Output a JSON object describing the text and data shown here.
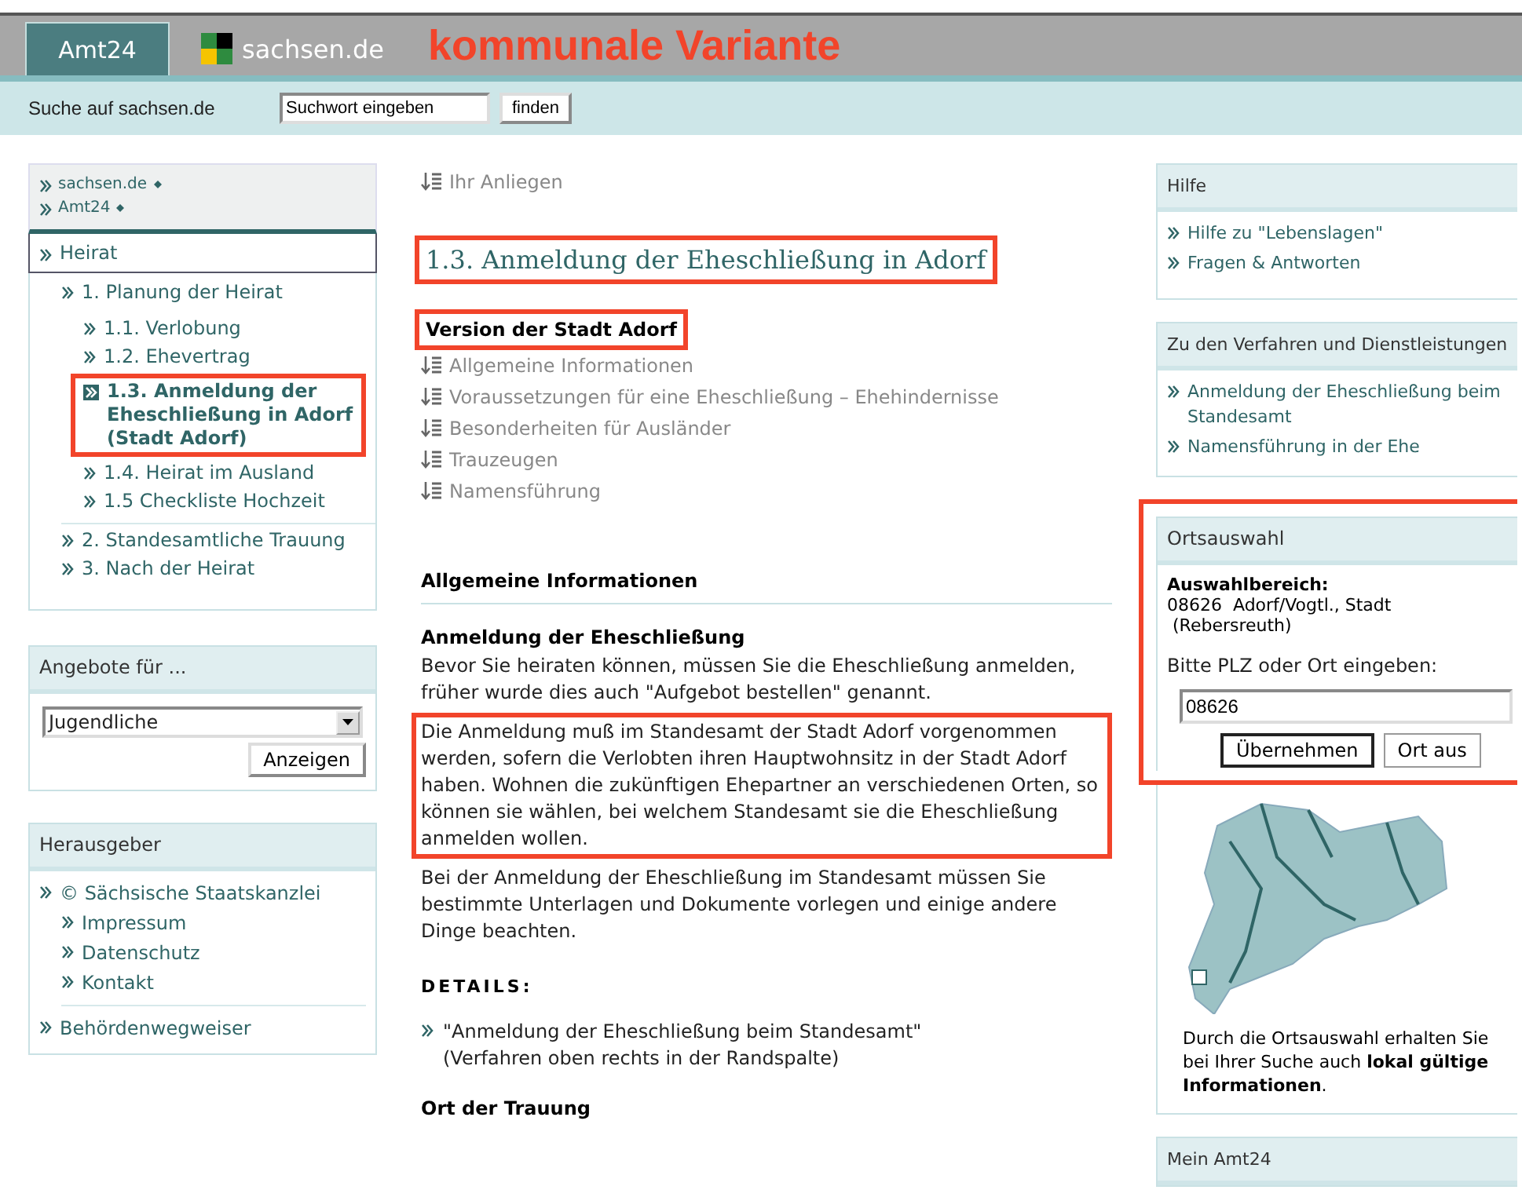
{
  "header": {
    "tab": {
      "label": "Amt24",
      "selected": true
    },
    "logo_text": "sachsen.de",
    "annotation": "kommunale Variante"
  },
  "search": {
    "label": "Suche auf sachsen.de",
    "value": "Suchwort eingeben",
    "button": "finden"
  },
  "breadcrumbs": [
    "sachsen.de",
    "Amt24"
  ],
  "nav": {
    "label": "Heirat",
    "children": [
      {
        "label": "1. Planung der Heirat",
        "selected": false,
        "highlighted": false,
        "children": [
          {
            "label": "1.1. Verlobung",
            "selected": false,
            "highlighted": false
          },
          {
            "label": "1.2. Ehevertrag",
            "selected": false,
            "highlighted": false
          },
          {
            "label": "1.3. Anmeldung der Eheschließung in Adorf (Stadt Adorf)",
            "selected": true,
            "highlighted": true
          },
          {
            "label": "1.4. Heirat im Ausland",
            "selected": false,
            "highlighted": false
          },
          {
            "label": "1.5 Checkliste Hochzeit",
            "selected": false,
            "highlighted": false
          }
        ]
      },
      {
        "label": "2. Standesamtliche Trauung",
        "selected": false,
        "highlighted": false
      },
      {
        "label": "3. Nach der Heirat",
        "selected": false,
        "highlighted": false
      }
    ]
  },
  "offers": {
    "title": "Angebote für ...",
    "select": "Jugendliche",
    "button": "Anzeigen"
  },
  "publisher": {
    "title": "Herausgeber",
    "items": [
      {
        "label": "© Sächsische Staatskanzlei",
        "children": [
          {
            "label": "Impressum"
          },
          {
            "label": "Datenschutz"
          },
          {
            "label": "Kontakt"
          }
        ]
      },
      {
        "label": "Behördenwegweiser"
      }
    ]
  },
  "main": {
    "top_link": "Ihr Anliegen",
    "title": {
      "text": "1.3. Anmeldung der Eheschließung in Adorf",
      "highlighted": true
    },
    "version": {
      "text": "Version der Stadt Adorf",
      "highlighted": true
    },
    "toc": [
      "Allgemeine Informationen",
      "Voraussetzungen für eine Eheschließung – Ehehindernisse",
      "Besonderheiten für Ausländer",
      "Trauzeugen",
      "Namensführung"
    ],
    "section": "Allgemeine Informationen",
    "subsection": "Anmeldung der Eheschließung",
    "paragraphs": [
      {
        "text": "Bevor Sie heiraten können, müssen Sie die Eheschließung anmelden, früher wurde dies auch \"Aufgebot bestellen\" genannt.",
        "highlighted": false
      },
      {
        "text": "Die Anmeldung muß im Standesamt der Stadt Adorf vorgenommen werden, sofern die Verlobten ihren Hauptwohnsitz in der Stadt Adorf haben. Wohnen die zukünftigen Ehepartner an verschiedenen Orten, so können sie wählen, bei welchem Standesamt sie die Eheschließung anmelden wollen.",
        "highlighted": true
      },
      {
        "text": "Bei der Anmeldung der Eheschließung im Standesamt müssen Sie bestimmte Unterlagen und Dokumente vorlegen und einige andere Dinge beachten.",
        "highlighted": false
      }
    ],
    "details_label": "DETAILS:",
    "details": [
      {
        "text": "\"Anmeldung der Eheschließung beim Standesamt\"",
        "note": "(Verfahren oben rechts in der Randspalte)"
      }
    ],
    "next_heading": "Ort der Trauung"
  },
  "right": {
    "help": {
      "title": "Hilfe",
      "links": [
        "Hilfe zu \"Lebenslagen\"",
        "Fragen & Antworten"
      ]
    },
    "procedures": {
      "title": "Zu den Verfahren und Dienstleistungen",
      "links": [
        "Anmeldung der Eheschließung beim Standesamt",
        "Namensführung in der Ehe"
      ]
    },
    "location": {
      "title": "Ortsauswahl",
      "highlighted": true,
      "area_label": "Auswahlbereich:",
      "area_lines": [
        "08626  Adorf/Vogtl., Stadt",
        "(Rebersreuth)"
      ],
      "prompt": "Bitte PLZ oder Ort eingeben:",
      "value": "08626",
      "buttons": [
        "Übernehmen",
        "Ort aus"
      ],
      "info": "Durch die Ortsauswahl erhalten Sie bei Ihrer Suche auch **lokal gültige Informationen**."
    },
    "my": {
      "title": "Mein Amt24"
    }
  }
}
